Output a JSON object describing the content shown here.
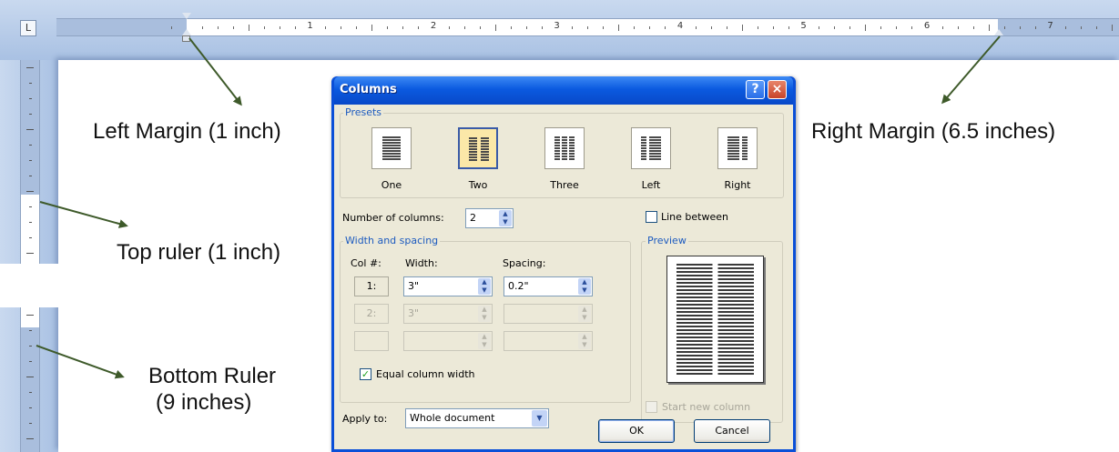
{
  "ruler": {
    "corner_icon": "tab-stop-left-icon",
    "numbers": [
      "1",
      "2",
      "3",
      "4",
      "5",
      "6",
      "7"
    ]
  },
  "annotations": {
    "left_margin": "Left Margin (1 inch)",
    "right_margin": "Right Margin (6.5 inches)",
    "top_ruler": "Top ruler (1 inch)",
    "bottom_ruler_line1": "Bottom Ruler",
    "bottom_ruler_line2": "(9 inches)"
  },
  "dialog": {
    "title": "Columns",
    "help_glyph": "?",
    "close_glyph": "×",
    "presets_label": "Presets",
    "presets": [
      {
        "label": "One",
        "icon": "one-column-icon",
        "selected": false
      },
      {
        "label": "Two",
        "icon": "two-columns-icon",
        "selected": true
      },
      {
        "label": "Three",
        "icon": "three-columns-icon",
        "selected": false
      },
      {
        "label": "Left",
        "icon": "left-column-icon",
        "selected": false
      },
      {
        "label": "Right",
        "icon": "right-column-icon",
        "selected": false
      }
    ],
    "number_of_columns_label": "Number of columns:",
    "number_of_columns_value": "2",
    "line_between_label": "Line between",
    "line_between_checked": false,
    "width_spacing_label": "Width and spacing",
    "col_header": "Col #:",
    "width_header": "Width:",
    "spacing_header": "Spacing:",
    "rows": [
      {
        "col": "1:",
        "width": "3\"",
        "spacing": "0.2\"",
        "enabled": true
      },
      {
        "col": "2:",
        "width": "3\"",
        "spacing": "",
        "enabled": false
      },
      {
        "col": "",
        "width": "",
        "spacing": "",
        "enabled": false
      }
    ],
    "equal_width_label": "Equal column width",
    "equal_width_checked": true,
    "preview_label": "Preview",
    "apply_to_label": "Apply to:",
    "apply_to_value": "Whole document",
    "start_new_column_label": "Start new column",
    "ok_label": "OK",
    "cancel_label": "Cancel"
  },
  "colors": {
    "word_blue": "#a9c1e3",
    "title_blue": "#0b5ae0",
    "dialog_face": "#ece9d8",
    "arrow_green": "#3e5a2a"
  }
}
